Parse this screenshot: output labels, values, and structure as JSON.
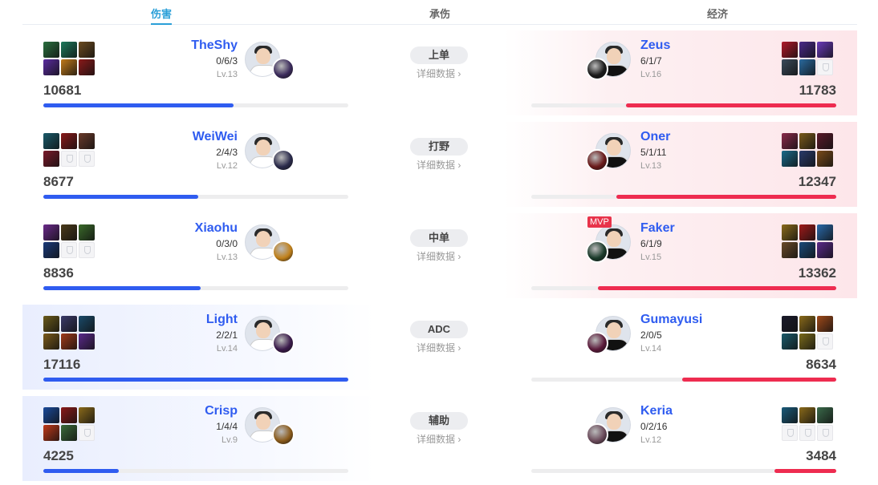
{
  "tabs": [
    "伤害",
    "承伤",
    "经济"
  ],
  "detail_label": "详细数据 ›",
  "mvp_label": "MVP",
  "max_value": 17116,
  "colors": {
    "left": "#2f5cf0",
    "right": "#ee2c50",
    "tab_active": "#2a9fd8"
  },
  "rows": [
    {
      "position": "上单",
      "left": {
        "name": "TheShy",
        "kda": "0/6/3",
        "level": "Lv.13",
        "value": "10681",
        "items": [
          "#2a6f3e",
          "#1e7a5c",
          "#6b4a1f",
          "#5a2ca0",
          "#c07a1a",
          "#8a1a1a"
        ],
        "champ": "#3a2a5a",
        "shirt": "#ffffff",
        "win": false
      },
      "right": {
        "name": "Zeus",
        "kda": "6/1/7",
        "level": "Lv.16",
        "value": "11783",
        "items": [
          "#b01a2a",
          "#4a2a8a",
          "#6a3aba",
          "#3a4a5a",
          "#2a6aa0",
          "empty"
        ],
        "champ": "#1a1a1a",
        "shirt": "#111111",
        "win": true,
        "mvp": false
      }
    },
    {
      "position": "打野",
      "left": {
        "name": "WeiWei",
        "kda": "2/4/3",
        "level": "Lv.12",
        "value": "8677",
        "items": [
          "#1a5a6a",
          "#8a1a1a",
          "#6a3a2a",
          "#7a1a2a",
          "empty",
          "empty"
        ],
        "champ": "#2a2a4a",
        "shirt": "#ffffff",
        "win": false
      },
      "right": {
        "name": "Oner",
        "kda": "5/1/11",
        "level": "Lv.13",
        "value": "12347",
        "items": [
          "#8a2a4a",
          "#7a5a1a",
          "#5a1a2a",
          "#1a6a8a",
          "#2a3a6a",
          "#7a4a1a"
        ],
        "champ": "#6a1a1a",
        "shirt": "#111111",
        "win": true,
        "mvp": false
      }
    },
    {
      "position": "中单",
      "left": {
        "name": "Xiaohu",
        "kda": "0/3/0",
        "level": "Lv.13",
        "value": "8836",
        "items": [
          "#6a2a8a",
          "#4a3a1a",
          "#3a6a2a",
          "#1a3a7a",
          "empty",
          "empty"
        ],
        "champ": "#c0801a",
        "shirt": "#ffffff",
        "win": false
      },
      "right": {
        "name": "Faker",
        "kda": "6/1/9",
        "level": "Lv.15",
        "value": "13362",
        "items": [
          "#8a6a1a",
          "#a01a1a",
          "#2a6aaa",
          "#6a4a2a",
          "#1a4a7a",
          "#5a2a8a"
        ],
        "champ": "#1a3a2a",
        "shirt": "#111111",
        "win": true,
        "mvp": true
      }
    },
    {
      "position": "ADC",
      "left": {
        "name": "Light",
        "kda": "2/2/1",
        "level": "Lv.14",
        "value": "17116",
        "items": [
          "#6a5a1a",
          "#3a3a6a",
          "#1a4a6a",
          "#7a5a1a",
          "#a03a1a",
          "#5a2a8a"
        ],
        "champ": "#3a1a4a",
        "shirt": "#ffffff",
        "win": true
      },
      "right": {
        "name": "Gumayusi",
        "kda": "2/0/5",
        "level": "Lv.14",
        "value": "8634",
        "items": [
          "#1a1a2a",
          "#8a6a1a",
          "#a04a1a",
          "#1a5a6a",
          "#7a6a1a",
          "empty"
        ],
        "champ": "#5a1a3a",
        "shirt": "#111111",
        "win": false,
        "mvp": false
      }
    },
    {
      "position": "辅助",
      "left": {
        "name": "Crisp",
        "kda": "1/4/4",
        "level": "Lv.9",
        "value": "4225",
        "items": [
          "#1a4a9a",
          "#8a1a1a",
          "#8a6a1a",
          "#c03a1a",
          "#3a6a3a",
          "empty"
        ],
        "champ": "#8a5a1a",
        "shirt": "#ffffff",
        "win": true
      },
      "right": {
        "name": "Keria",
        "kda": "0/2/16",
        "level": "Lv.12",
        "value": "3484",
        "items": [
          "#1a5a7a",
          "#8a6a1a",
          "#3a6a4a",
          "empty",
          "empty",
          "empty"
        ],
        "champ": "#6a4a5a",
        "shirt": "#111111",
        "win": false,
        "mvp": false
      }
    }
  ]
}
